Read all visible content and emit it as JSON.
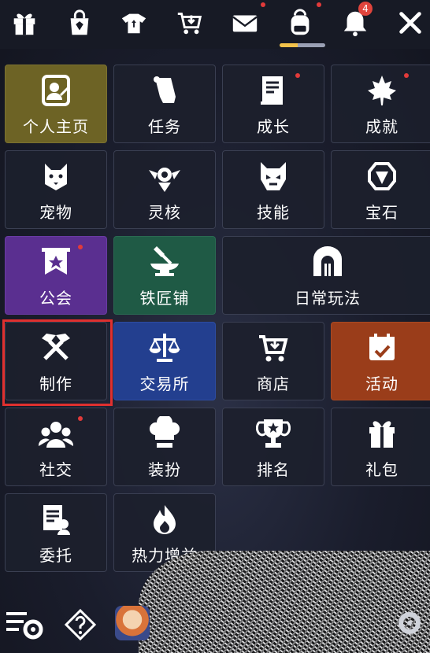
{
  "topbar": {
    "icons": [
      "gift-icon",
      "shop-bag-icon",
      "wardrobe-shirt-icon",
      "cart-icon",
      "mail-icon",
      "backpack-icon",
      "bell-icon",
      "close-icon"
    ],
    "notification_count": "4"
  },
  "menu": {
    "personal_home": "个人主页",
    "task": "任务",
    "growth": "成长",
    "achievement": "成就",
    "pet": "宠物",
    "spirit_core": "灵核",
    "skill": "技能",
    "gem": "宝石",
    "guild": "公会",
    "blacksmith": "铁匠铺",
    "daily_play": "日常玩法",
    "craft": "制作",
    "exchange": "交易所",
    "shop": "商店",
    "event": "活动",
    "social": "社交",
    "dressup": "装扮",
    "ranking": "排名",
    "gift_pack": "礼包",
    "commission": "委托",
    "heat_boost": "热力增益"
  },
  "colors": {
    "olive": "#6d6325",
    "purple": "#5a2f90",
    "green": "#1f5a45",
    "blue": "#233f8f",
    "rust": "#9a3d1a",
    "highlight": "#e0302f",
    "badge": "#e0443c"
  }
}
